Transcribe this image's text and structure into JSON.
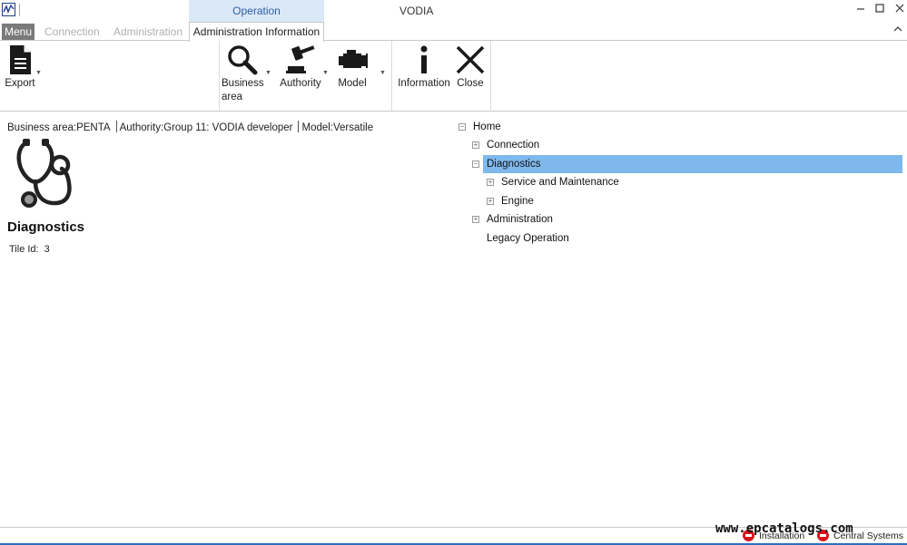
{
  "window": {
    "title": "VODIA",
    "context_tab": "Operation"
  },
  "tabs": {
    "menu": "Menu",
    "items": [
      "Connection",
      "Administration"
    ],
    "active": "Administration Information"
  },
  "ribbon": {
    "export": "Export",
    "business_area": "Business area",
    "authority": "Authority",
    "model": "Model",
    "information": "Information",
    "close": "Close"
  },
  "info": {
    "business_area": "Business area:PENTA",
    "authority": "Authority:Group 11: VODIA developer",
    "model": "Model:Versatile"
  },
  "tile": {
    "icon": "stethoscope-icon",
    "title": "Diagnostics",
    "id_label": "Tile Id:",
    "id_value": "3"
  },
  "tree": {
    "root": "Home",
    "nodes": [
      "Connection",
      "Diagnostics",
      "Service and Maintenance",
      "Engine",
      "Administration",
      "Legacy Operation"
    ],
    "selected": "Diagnostics"
  },
  "status": {
    "installation": "Installation",
    "central_systems": "Central Systems",
    "watermark": "www.epcatalogs.com"
  },
  "colors": {
    "selected_row": "#7fb8ec",
    "context_tab": "#dbe8f7",
    "status_error": "#d9141c",
    "status_border": "#2c6fbe"
  }
}
